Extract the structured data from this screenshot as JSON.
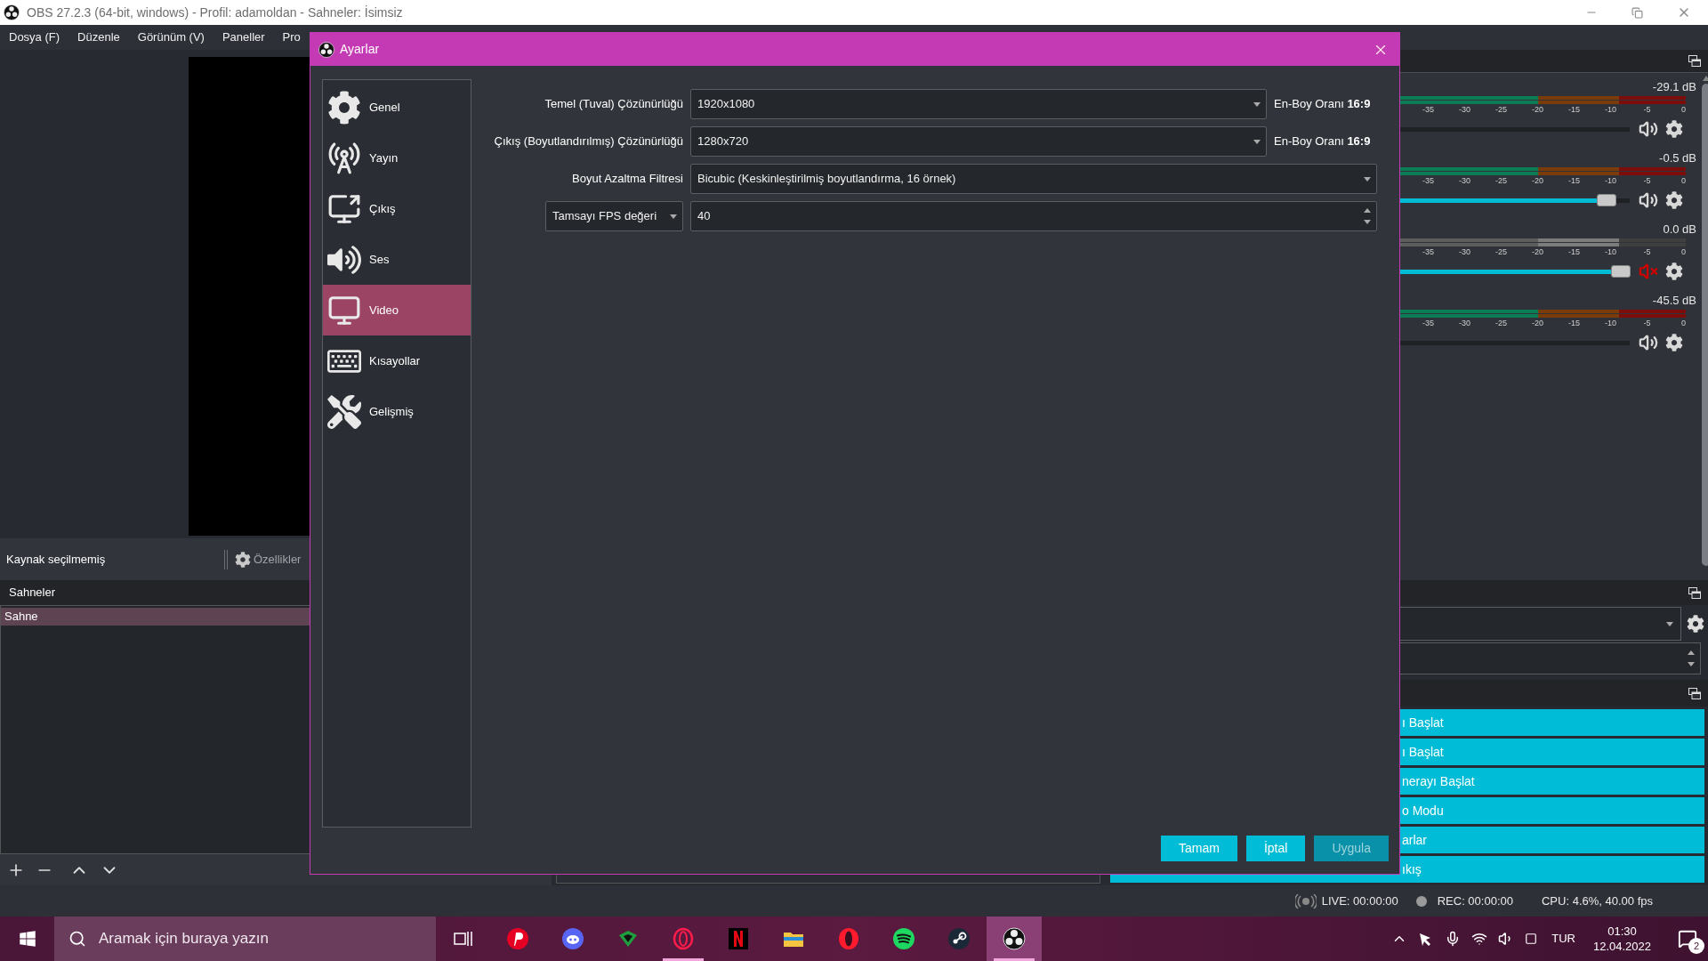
{
  "window": {
    "title": "OBS 27.2.3 (64-bit, windows) - Profil: adamoldan - Sahneler: İsimsiz",
    "menu": [
      "Dosya (F)",
      "Düzenle",
      "Görünüm (V)",
      "Paneller",
      "Pro"
    ]
  },
  "source_bar": {
    "label": "Kaynak seçilmemiş",
    "properties_button": "Özellikler"
  },
  "scenes": {
    "title": "Sahneler",
    "items": [
      {
        "label": "Sahne",
        "selected": true
      }
    ]
  },
  "mixer": {
    "channels": [
      {
        "reading": "-29.1 dB",
        "muted": false,
        "level": 0,
        "scale": [
          "-35",
          "-30",
          "-25",
          "-20",
          "-15",
          "-10",
          "-5",
          "0"
        ]
      },
      {
        "reading": "-0.5 dB",
        "muted": false,
        "level": 0.9,
        "scale": [
          "-35",
          "-30",
          "-25",
          "-20",
          "-15",
          "-10",
          "-5",
          "0"
        ]
      },
      {
        "reading": "0.0 dB",
        "muted": true,
        "level": 0.96,
        "scale": [
          "-35",
          "-30",
          "-25",
          "-20",
          "-15",
          "-10",
          "-5",
          "0"
        ]
      },
      {
        "reading": "-45.5 dB",
        "muted": false,
        "level": 0,
        "scale": [
          "-35",
          "-30",
          "-25",
          "-20",
          "-15",
          "-10",
          "-5",
          "0"
        ]
      }
    ]
  },
  "controls": {
    "buttons": [
      "ı Başlat",
      "ı Başlat",
      "nerayı Başlat",
      "o Modu",
      "arlar",
      "ıkış"
    ]
  },
  "status_bar": {
    "live": "LIVE: 00:00:00",
    "rec": "REC: 00:00:00",
    "cpu": "CPU: 4.6%, 40.00 fps"
  },
  "settings_dialog": {
    "title": "Ayarlar",
    "categories": [
      {
        "label": "Genel",
        "selected": false
      },
      {
        "label": "Yayın",
        "selected": false
      },
      {
        "label": "Çıkış",
        "selected": false
      },
      {
        "label": "Ses",
        "selected": false
      },
      {
        "label": "Video",
        "selected": true
      },
      {
        "label": "Kısayollar",
        "selected": false
      },
      {
        "label": "Gelişmiş",
        "selected": false
      }
    ],
    "fields": [
      {
        "kind": "combo",
        "label": "Temel (Tuval) Çözünürlüğü",
        "value": "1920x1080",
        "aspect": "En-Boy Oranı **16:9**"
      },
      {
        "kind": "combo",
        "label": "Çıkış (Boyutlandırılmış) Çözünürlüğü",
        "value": "1280x720",
        "aspect": "En-Boy Oranı **16:9**"
      },
      {
        "kind": "combo",
        "label": "Boyut Azaltma Filtresi",
        "value": "Bicubic (Keskinleştirilmiş boyutlandırma, 16 örnek)"
      },
      {
        "kind": "spin",
        "mode": "Tamsayı FPS değeri",
        "value": "40"
      }
    ],
    "buttons": [
      {
        "label": "Tamam",
        "disabled": false
      },
      {
        "label": "İptal",
        "disabled": false
      },
      {
        "label": "Uygula",
        "disabled": true
      }
    ]
  },
  "taskbar": {
    "search": {
      "placeholder": "Aramak için buraya yazın"
    },
    "apps": [
      {
        "running": false,
        "selected": false
      },
      {
        "running": false,
        "selected": false
      },
      {
        "running": false,
        "selected": false
      },
      {
        "running": true,
        "selected": false
      },
      {
        "running": false,
        "selected": false
      },
      {
        "running": false,
        "selected": false
      },
      {
        "running": false,
        "selected": false
      },
      {
        "running": false,
        "selected": false
      },
      {
        "running": false,
        "selected": false
      },
      {
        "running": true,
        "selected": true
      }
    ],
    "language": "TUR",
    "time": "01:30",
    "date": "12.04.2022",
    "notifications": "2"
  }
}
